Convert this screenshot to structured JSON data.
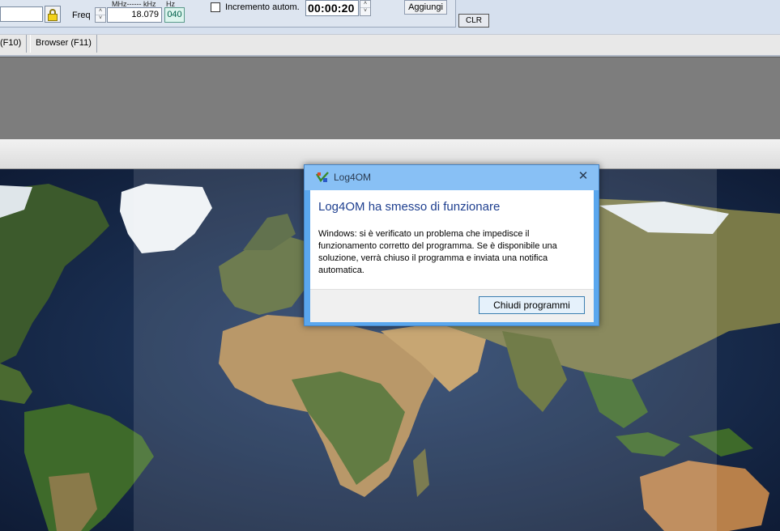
{
  "toolbar": {
    "freq_label": "Freq",
    "mhz_khz_header": "MHz------ kHz",
    "hz_header": "Hz",
    "frequency_value": "18.079",
    "hz_value": "040",
    "auto_increment_label": "Incremento autom.",
    "auto_increment_checked": false,
    "timer_value": "00:00:20",
    "add_button": "Aggiungi",
    "clr_button": "CLR",
    "spinner_up": "˄",
    "spinner_down": "˅"
  },
  "tabs": [
    {
      "label": "(F10)"
    },
    {
      "label": "Browser (F11)"
    }
  ],
  "dialog": {
    "title": "Log4OM",
    "close_glyph": "✕",
    "heading": "Log4OM ha smesso di funzionare",
    "message": "Windows: si è verificato un problema che impedisce il funzionamento corretto del programma. Se è disponibile una soluzione, verrà chiuso il programma e inviata una notifica automatica.",
    "button": "Chiudi programmi"
  },
  "colors": {
    "dialog_frame": "#5aa7ee",
    "dialog_title": "#88c0f5",
    "heading_text": "#1e3f8f",
    "hz_field": "#ddf5ee",
    "ocean": "#1b2a4a"
  }
}
